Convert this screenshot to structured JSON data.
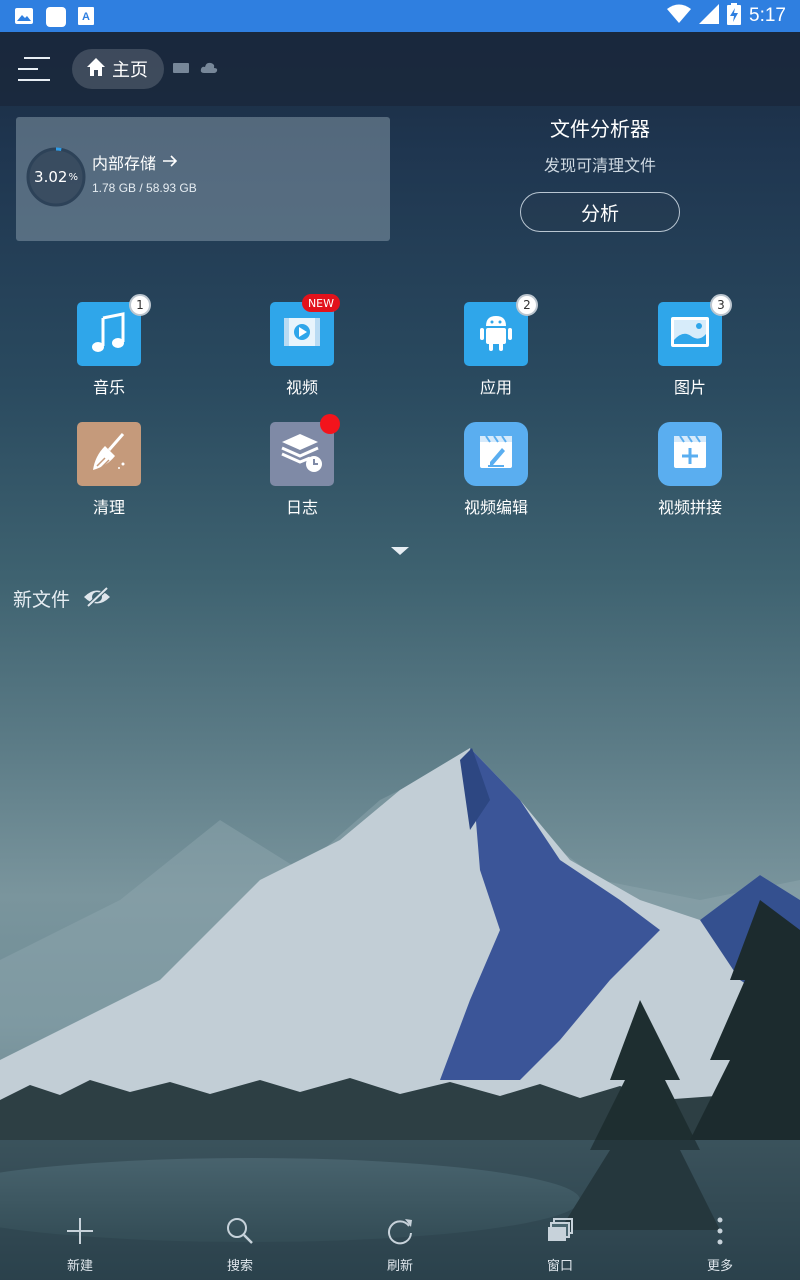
{
  "status_bar": {
    "time": "5:17",
    "left_icons": [
      "image-icon",
      "app-icon",
      "a-icon"
    ],
    "right_icons": [
      "wifi-icon",
      "signal-icon",
      "battery-charging-icon"
    ]
  },
  "toolbar": {
    "home_label": "主页"
  },
  "storage": {
    "percent": "3.02",
    "percent_symbol": "%",
    "title": "内部存储",
    "usage": "1.78 GB / 58.93 GB"
  },
  "analyzer": {
    "title": "文件分析器",
    "subtitle": "发现可清理文件",
    "button": "分析"
  },
  "categories": [
    {
      "label": "音乐",
      "badge": "1"
    },
    {
      "label": "视频",
      "badge": "NEW"
    },
    {
      "label": "应用",
      "badge": "2"
    },
    {
      "label": "图片",
      "badge": "3"
    },
    {
      "label": "清理"
    },
    {
      "label": "日志"
    },
    {
      "label": "视频编辑"
    },
    {
      "label": "视频拼接"
    }
  ],
  "new_files": {
    "label": "新文件"
  },
  "bottom_bar": {
    "items": [
      {
        "label": "新建",
        "icon": "plus-icon"
      },
      {
        "label": "搜索",
        "icon": "search-icon"
      },
      {
        "label": "刷新",
        "icon": "refresh-icon"
      },
      {
        "label": "窗口",
        "icon": "windows-icon"
      },
      {
        "label": "更多",
        "icon": "more-vertical-icon"
      }
    ]
  },
  "colors": {
    "status_bar": "#2f7fe0",
    "tile_blue": "#2fa6ea",
    "tile_clean": "#c59a7b",
    "tile_log": "#7f8aa6",
    "tile_edit": "#5aaef0",
    "badge_red": "#e2121b"
  }
}
